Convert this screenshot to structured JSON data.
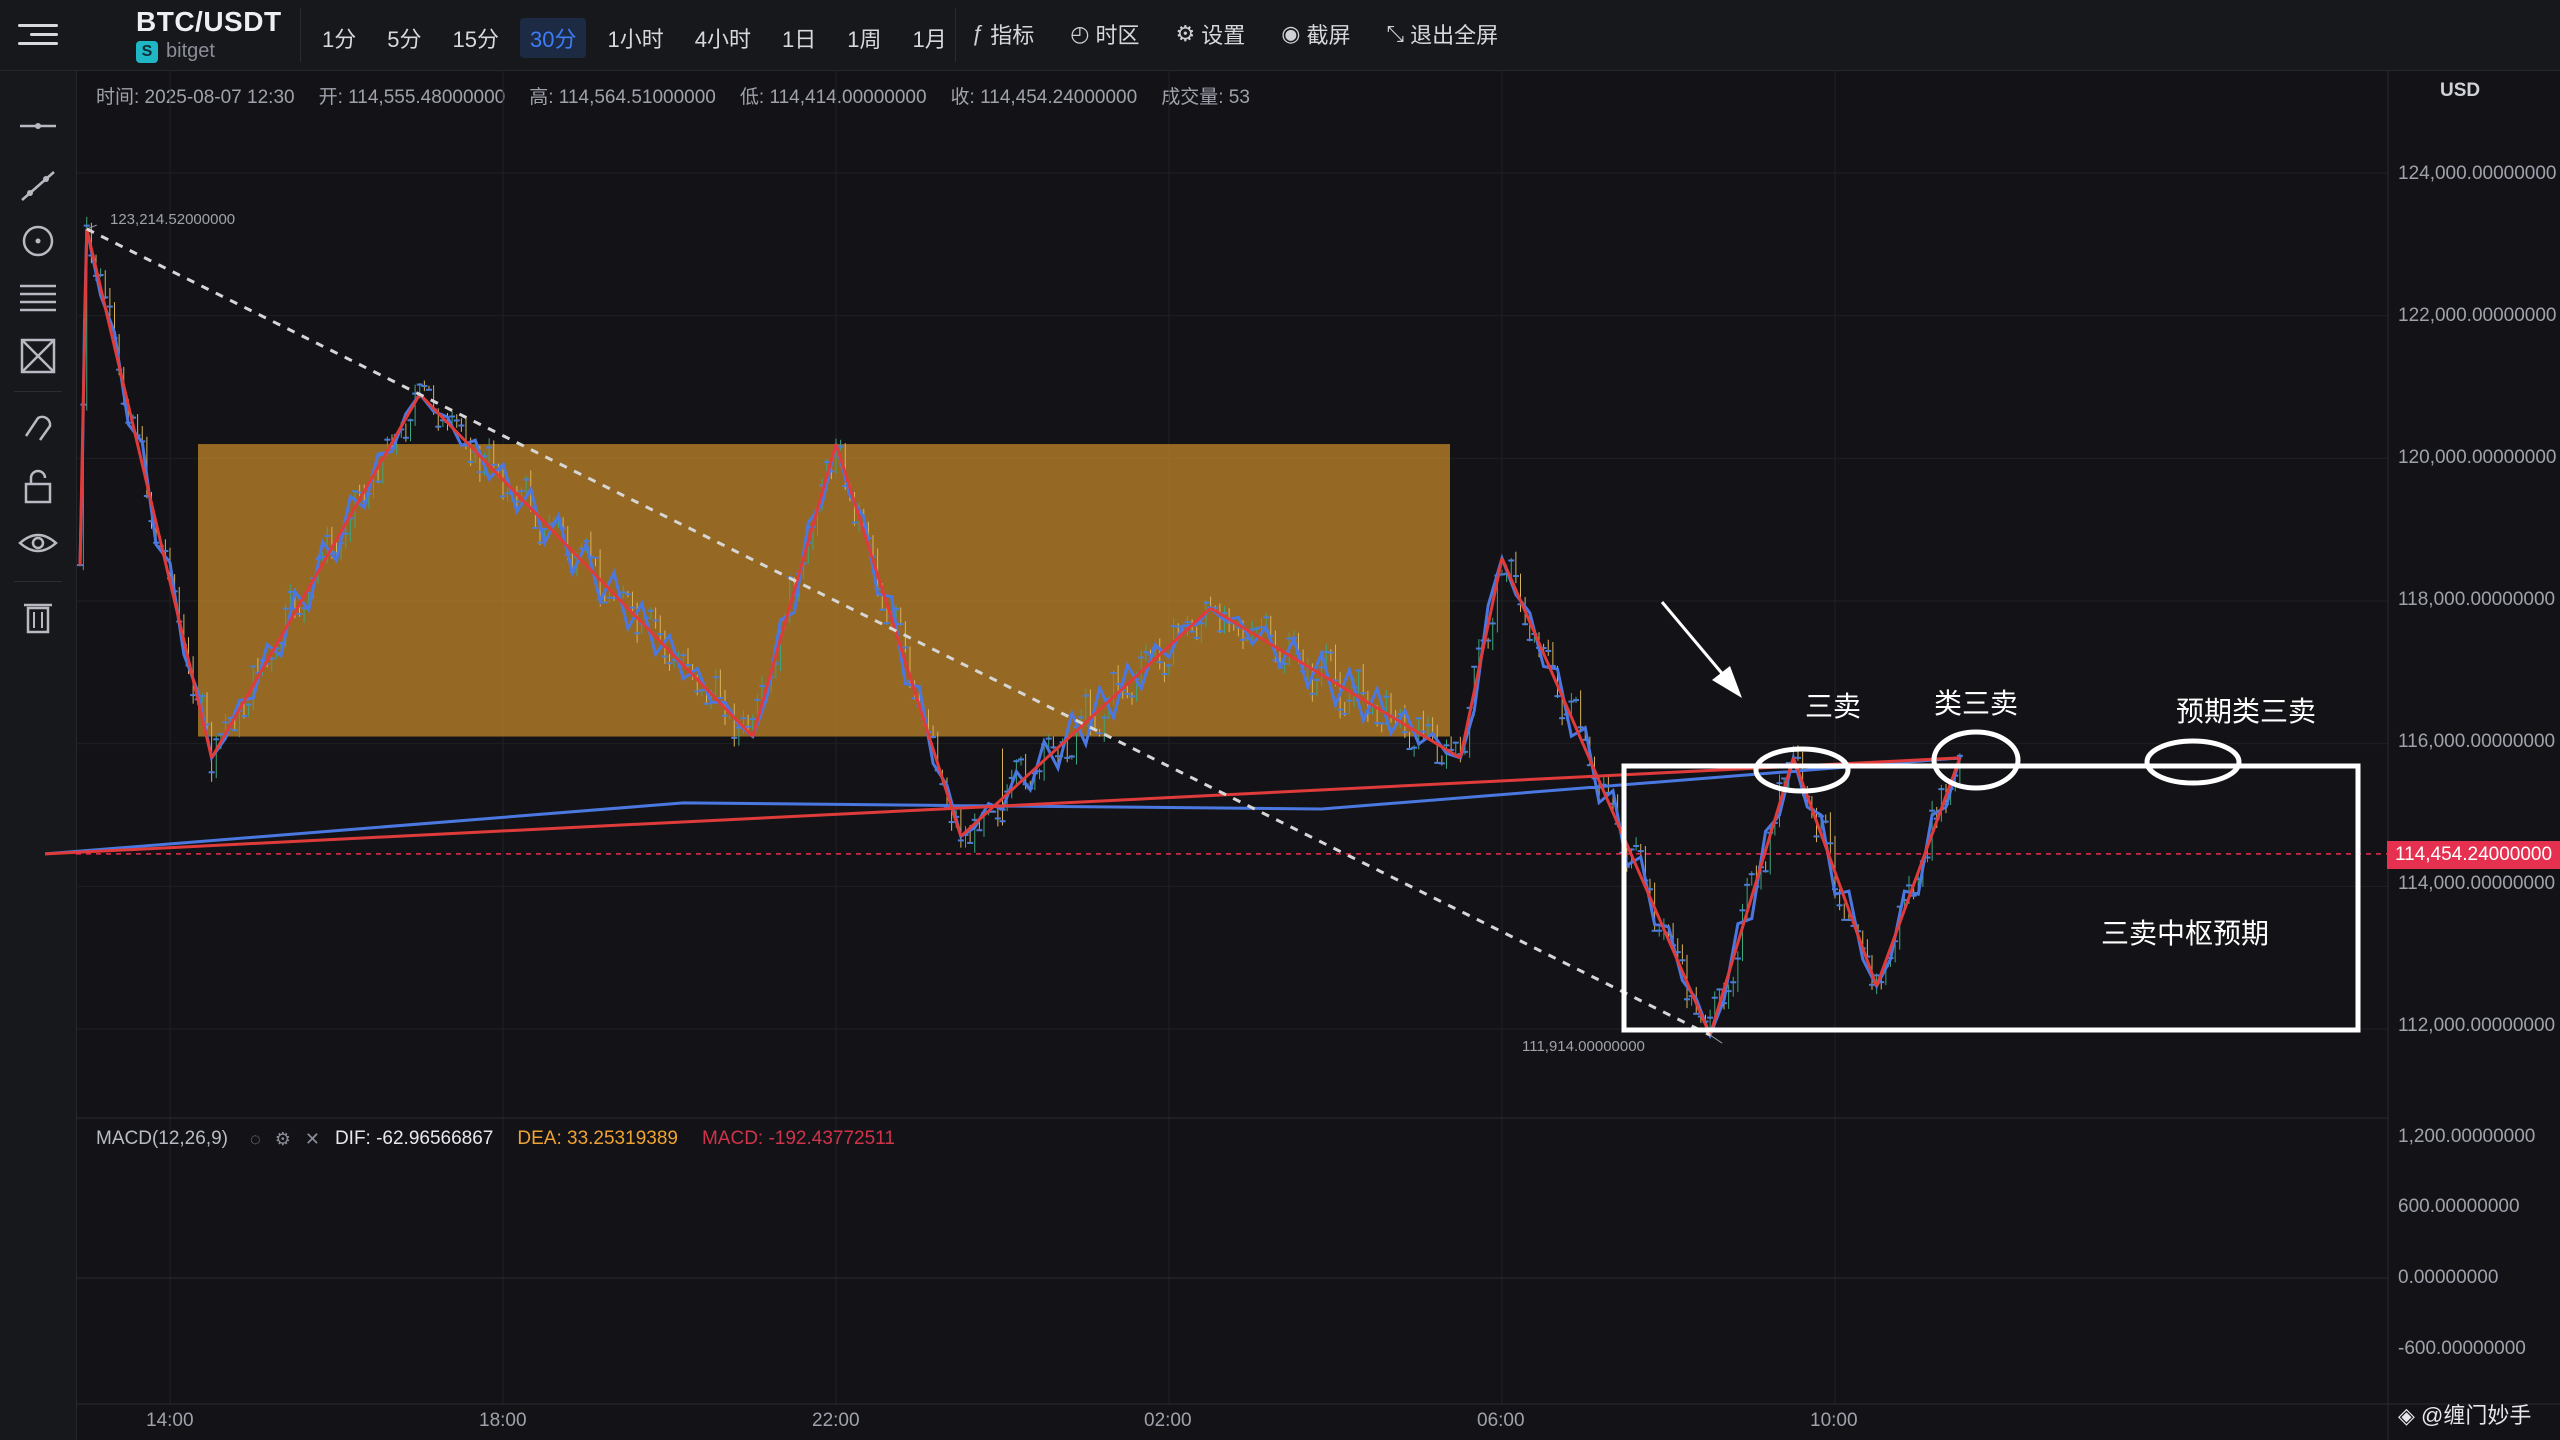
{
  "header": {
    "symbol": "BTC/USDT",
    "exchange": "bitget",
    "intervals": [
      "1分",
      "5分",
      "15分",
      "30分",
      "1小时",
      "4小时",
      "1日",
      "1周",
      "1月"
    ],
    "active_interval": "30分",
    "tools": [
      {
        "icon": "indicator-icon",
        "label": "指标"
      },
      {
        "icon": "globe-clock-icon",
        "label": "时区"
      },
      {
        "icon": "gear-icon",
        "label": "设置"
      },
      {
        "icon": "camera-icon",
        "label": "截屏"
      },
      {
        "icon": "exit-fullscreen-icon",
        "label": "退出全屏"
      }
    ]
  },
  "sidebar_tools": [
    "horizontal-line-icon",
    "trend-line-icon",
    "circle-target-icon",
    "fib-lines-icon",
    "pattern-icon",
    "magnet-icon",
    "lock-icon",
    "eye-icon",
    "trash-icon"
  ],
  "ohlc": {
    "time": "时间: 2025-08-07 12:30",
    "open": "开: 114,555.48000000",
    "high": "高: 114,564.51000000",
    "low": "低: 114,414.00000000",
    "close": "收: 114,454.24000000",
    "volume": "成交量: 53"
  },
  "currency": "USD",
  "price_axis": [
    "124,000.00000000",
    "122,000.00000000",
    "120,000.00000000",
    "118,000.00000000",
    "116,000.00000000",
    "114,000.00000000",
    "112,000.00000000"
  ],
  "current_price": "114,454.24000000",
  "high_marker": "123,214.52000000",
  "low_marker": "111,914.00000000",
  "macd": {
    "name": "MACD(12,26,9)",
    "dif": "DIF: -62.96566867",
    "dea": "DEA: 33.25319389",
    "macd": "MACD: -192.43772511",
    "axis": [
      "1,200.00000000",
      "600.00000000",
      "0.00000000",
      "-600.00000000"
    ],
    "colors": {
      "dif": "#ffffff",
      "dea": "#f0a232",
      "macd_text": "#d0334a",
      "hist_up": "#26a17b",
      "hist_down": "#e0334d"
    }
  },
  "time_axis": [
    "14:00",
    "18:00",
    "22:00",
    "02:00",
    "06:00",
    "10:00"
  ],
  "annotations": {
    "sell3": "三卖",
    "sell3_like": "类三卖",
    "expected": "预期类三卖",
    "box_label": "三卖中枢预期"
  },
  "watermark": "@缠门妙手",
  "chart_data": {
    "type": "line",
    "title": "BTC/USDT 30分",
    "x": [
      "14:00",
      "18:00",
      "22:00",
      "02:00",
      "06:00",
      "10:00"
    ],
    "price_range": [
      111914.0,
      123214.52
    ],
    "pivot_zone": [
      116100,
      120200
    ],
    "stroke_points": [
      {
        "time": "12:30",
        "price": 118500
      },
      {
        "time": "13:00",
        "price": 123214.52
      },
      {
        "time": "14:30",
        "price": 115800
      },
      {
        "time": "17:00",
        "price": 120900
      },
      {
        "time": "21:00",
        "price": 116100
      },
      {
        "time": "22:00",
        "price": 120200
      },
      {
        "time": "23:30",
        "price": 114700
      },
      {
        "time": "02:30",
        "price": 117900
      },
      {
        "time": "05:30",
        "price": 115800
      },
      {
        "time": "06:00",
        "price": 118600
      },
      {
        "time": "08:30",
        "price": 111914.0
      },
      {
        "time": "09:30",
        "price": 115800
      },
      {
        "time": "10:30",
        "price": 112600
      },
      {
        "time": "11:30",
        "price": 115800
      },
      {
        "time": "12:30",
        "price": 114454.24
      }
    ],
    "last_close": 114454.24,
    "macd_range": [
      -900,
      1200
    ]
  }
}
